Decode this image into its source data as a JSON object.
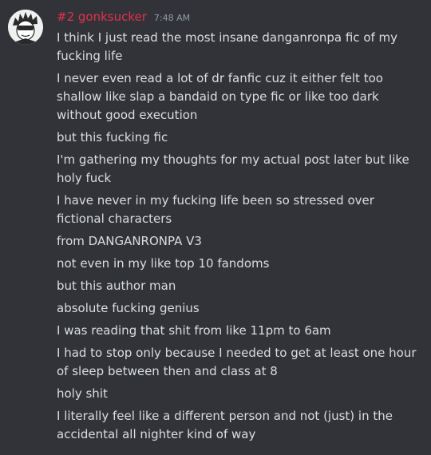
{
  "message": {
    "author": "#2 gonksucker",
    "timestamp": "7:48 AM",
    "author_color": "#e4314b",
    "avatar_icon": "avatar-icon",
    "lines": [
      "I think I just read the most insane danganronpa fic of my fucking life",
      "I never even read a lot of dr fanfic cuz it either felt too shallow like slap a bandaid on type fic or like too dark without good execution",
      "but this fucking fic",
      "I'm gathering my thoughts for my actual post later but like holy fuck",
      "I have never in my fucking life been so stressed over fictional characters",
      "from DANGANRONPA V3",
      "not even in my like top 10 fandoms",
      "but this author man",
      "absolute fucking genius",
      "I was reading that shit from like 11pm to 6am",
      "I had to stop only because I needed to get at least one hour of sleep between then and class at 8",
      "holy shit",
      "I literally feel like a different person and not (just) in the accidental all nighter kind of way"
    ]
  },
  "colors": {
    "background": "#313338",
    "text": "#dbdee1",
    "timestamp": "#949ba4"
  }
}
